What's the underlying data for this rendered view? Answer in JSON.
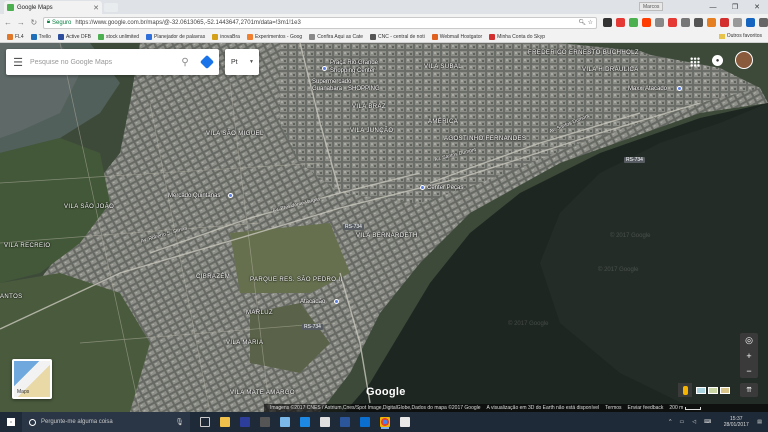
{
  "browser": {
    "tab_title": "Google Maps",
    "user_label": "Marcos",
    "secure_label": "Seguro",
    "url": "https://www.google.com.br/maps/@-32.0613065,-52.1443647,2701m/data=!3m1!1e3"
  },
  "bookmarks": [
    {
      "label": "FL4",
      "color": "#e0782c"
    },
    {
      "label": "Trello",
      "color": "#1f70b8"
    },
    {
      "label": "Active DFB",
      "color": "#2b4d9b"
    },
    {
      "label": "stock unlimited",
      "color": "#4caf50"
    },
    {
      "label": "Planejador de palavras",
      "color": "#2f6fdc"
    },
    {
      "label": "inovaBra",
      "color": "#d3a018"
    },
    {
      "label": "Experimentos - Goog",
      "color": "#f08030"
    },
    {
      "label": "Confira Aqui as Cate",
      "color": "#888888"
    },
    {
      "label": "CNC - central de noti",
      "color": "#555555"
    },
    {
      "label": "Webmail Hostgator",
      "color": "#e06020"
    },
    {
      "label": "Minha Conta do Skyp",
      "color": "#d32f2f"
    }
  ],
  "bookmarks_other": "Outros favoritos",
  "search": {
    "placeholder": "Pesquise no Google Maps"
  },
  "language": "Pt",
  "map": {
    "brand": "Google",
    "thumb_label": "Maps",
    "footer": {
      "attribution": "Imagens ©2017 CNES / Astrium,Cnes/Spot Image,DigitalGlobe,Dados do mapa ©2017 Google",
      "notice": "A visualização em 3D do Earth não está disponível",
      "terms": "Termos",
      "feedback": "Enviar feedback",
      "scale": "200 m"
    },
    "areas": [
      "VILA SÃO MIGUEL",
      "VILA SÃO JOÃO",
      "VILA RECREIO",
      "VILA JUNÇÃO",
      "VILA BRAZ",
      "AMÉRICA",
      "AGOSTINHO FERNANDES",
      "VILA BERNARDETH",
      "CIBRAZÉM",
      "PARQUE RES. SÃO PEDRO II",
      "MARLUZ",
      "VILA MARIA",
      "VILA MATE AMARGO",
      "VILA SUBAL",
      "FREDERICO ERNESTO BUCHHOLZ",
      "VILA HIDRÁULICA",
      "ANTOS"
    ],
    "places": [
      "Praça Rio Grande",
      "Shopping Center",
      "Supermercado",
      "Guanabara",
      "SHOPPING",
      "Mercado Quintanas",
      "Center Peças",
      "Atacadão",
      "Maxxi Atacado"
    ],
    "roads": [
      "RS-734",
      "RS-734",
      "RS-734"
    ],
    "streets": [
      "Av. Santos Dumont",
      "Av. Santos Dumont",
      "Av. Presidente Vargas",
      "Av. Roberto S. Senna"
    ],
    "watermark": "© 2017 Google"
  },
  "taskbar": {
    "search_placeholder": "Pergunte-me alguma coisa",
    "time": "15:37",
    "date": "28/01/2017"
  }
}
